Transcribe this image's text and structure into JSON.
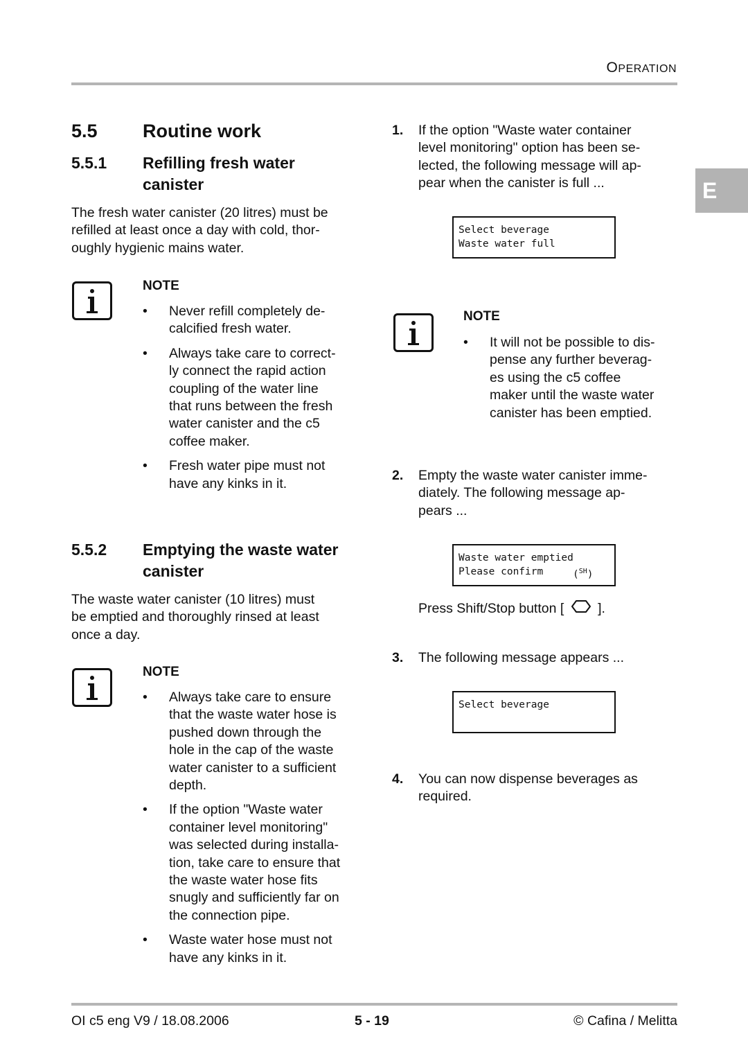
{
  "header": {
    "section_cap": "O",
    "section_rest": "PERATION"
  },
  "side_tab": "E",
  "left": {
    "h1": {
      "num": "5.5",
      "title": "Routine work"
    },
    "s1": {
      "num": "5.5.1",
      "title_l1": "Refilling fresh water",
      "title_l2": "canister",
      "body": [
        "The fresh water canister (20 litres) must be",
        "refilled at least once a day with cold, thor-",
        "oughly hygienic mains water."
      ],
      "note": {
        "label": "NOTE",
        "icon": "info-icon",
        "bullets": [
          [
            "Never refill completely de-",
            "calcified fresh water."
          ],
          [
            "Always take care to correct-",
            "ly connect the rapid action",
            "coupling of the water line",
            "that runs between the fresh",
            "water canister and the c5",
            "coffee maker."
          ],
          [
            "Fresh water pipe must not",
            "have any kinks in it."
          ]
        ]
      }
    },
    "s2": {
      "num": "5.5.2",
      "title_l1": "Emptying the waste water",
      "title_l2": "canister",
      "body": [
        "The waste water canister (10 litres) must",
        "be emptied and thoroughly rinsed at least",
        "once a day."
      ],
      "note": {
        "label": "NOTE",
        "icon": "info-icon",
        "bullets": [
          [
            "Always take care to ensure",
            "that the waste water hose is",
            "pushed down through the",
            "hole in the cap of the waste",
            "water canister to a sufficient",
            "depth."
          ],
          [
            "If the option \"Waste water",
            "container level monitoring\"",
            "was selected during installa-",
            "tion, take care to ensure that",
            "the waste water hose fits",
            "snugly and sufficiently far on",
            "the connection pipe."
          ],
          [
            "Waste water hose must not",
            "have any kinks in it."
          ]
        ]
      }
    }
  },
  "right": {
    "steps": [
      {
        "n": "1.",
        "lines": [
          "If the option \"Waste water container",
          "level monitoring\" option has been se-",
          "lected, the following message will ap-",
          "pear when the canister is full ..."
        ]
      },
      {
        "n": "2.",
        "lines": [
          "Empty the waste water canister imme-",
          "diately. The following message ap-",
          "pears ..."
        ]
      },
      {
        "n": "3.",
        "lines": [
          "The following message appears ..."
        ]
      },
      {
        "n": "4.",
        "lines": [
          "You can now dispense beverages as",
          "required."
        ]
      }
    ],
    "lcd1": [
      "Select beverage",
      "Waste water full"
    ],
    "lcd2": {
      "l1": "Waste water emptied",
      "l2": "Please confirm",
      "sup": "SH"
    },
    "lcd3": [
      "Select beverage"
    ],
    "note": {
      "label": "NOTE",
      "lines": [
        "It will not be possible to dis-",
        "pense any further beverag-",
        "es using the c5 coffee",
        "maker until the waste water",
        "canister has been emptied."
      ]
    },
    "press": {
      "before": "Press Shift/Stop button [",
      "after": "]."
    }
  },
  "footer": {
    "left": "OI c5 eng V9 / 18.08.2006",
    "center": "5 - 19",
    "right": "© Cafina / Melitta"
  },
  "bullet_glyph": "•"
}
